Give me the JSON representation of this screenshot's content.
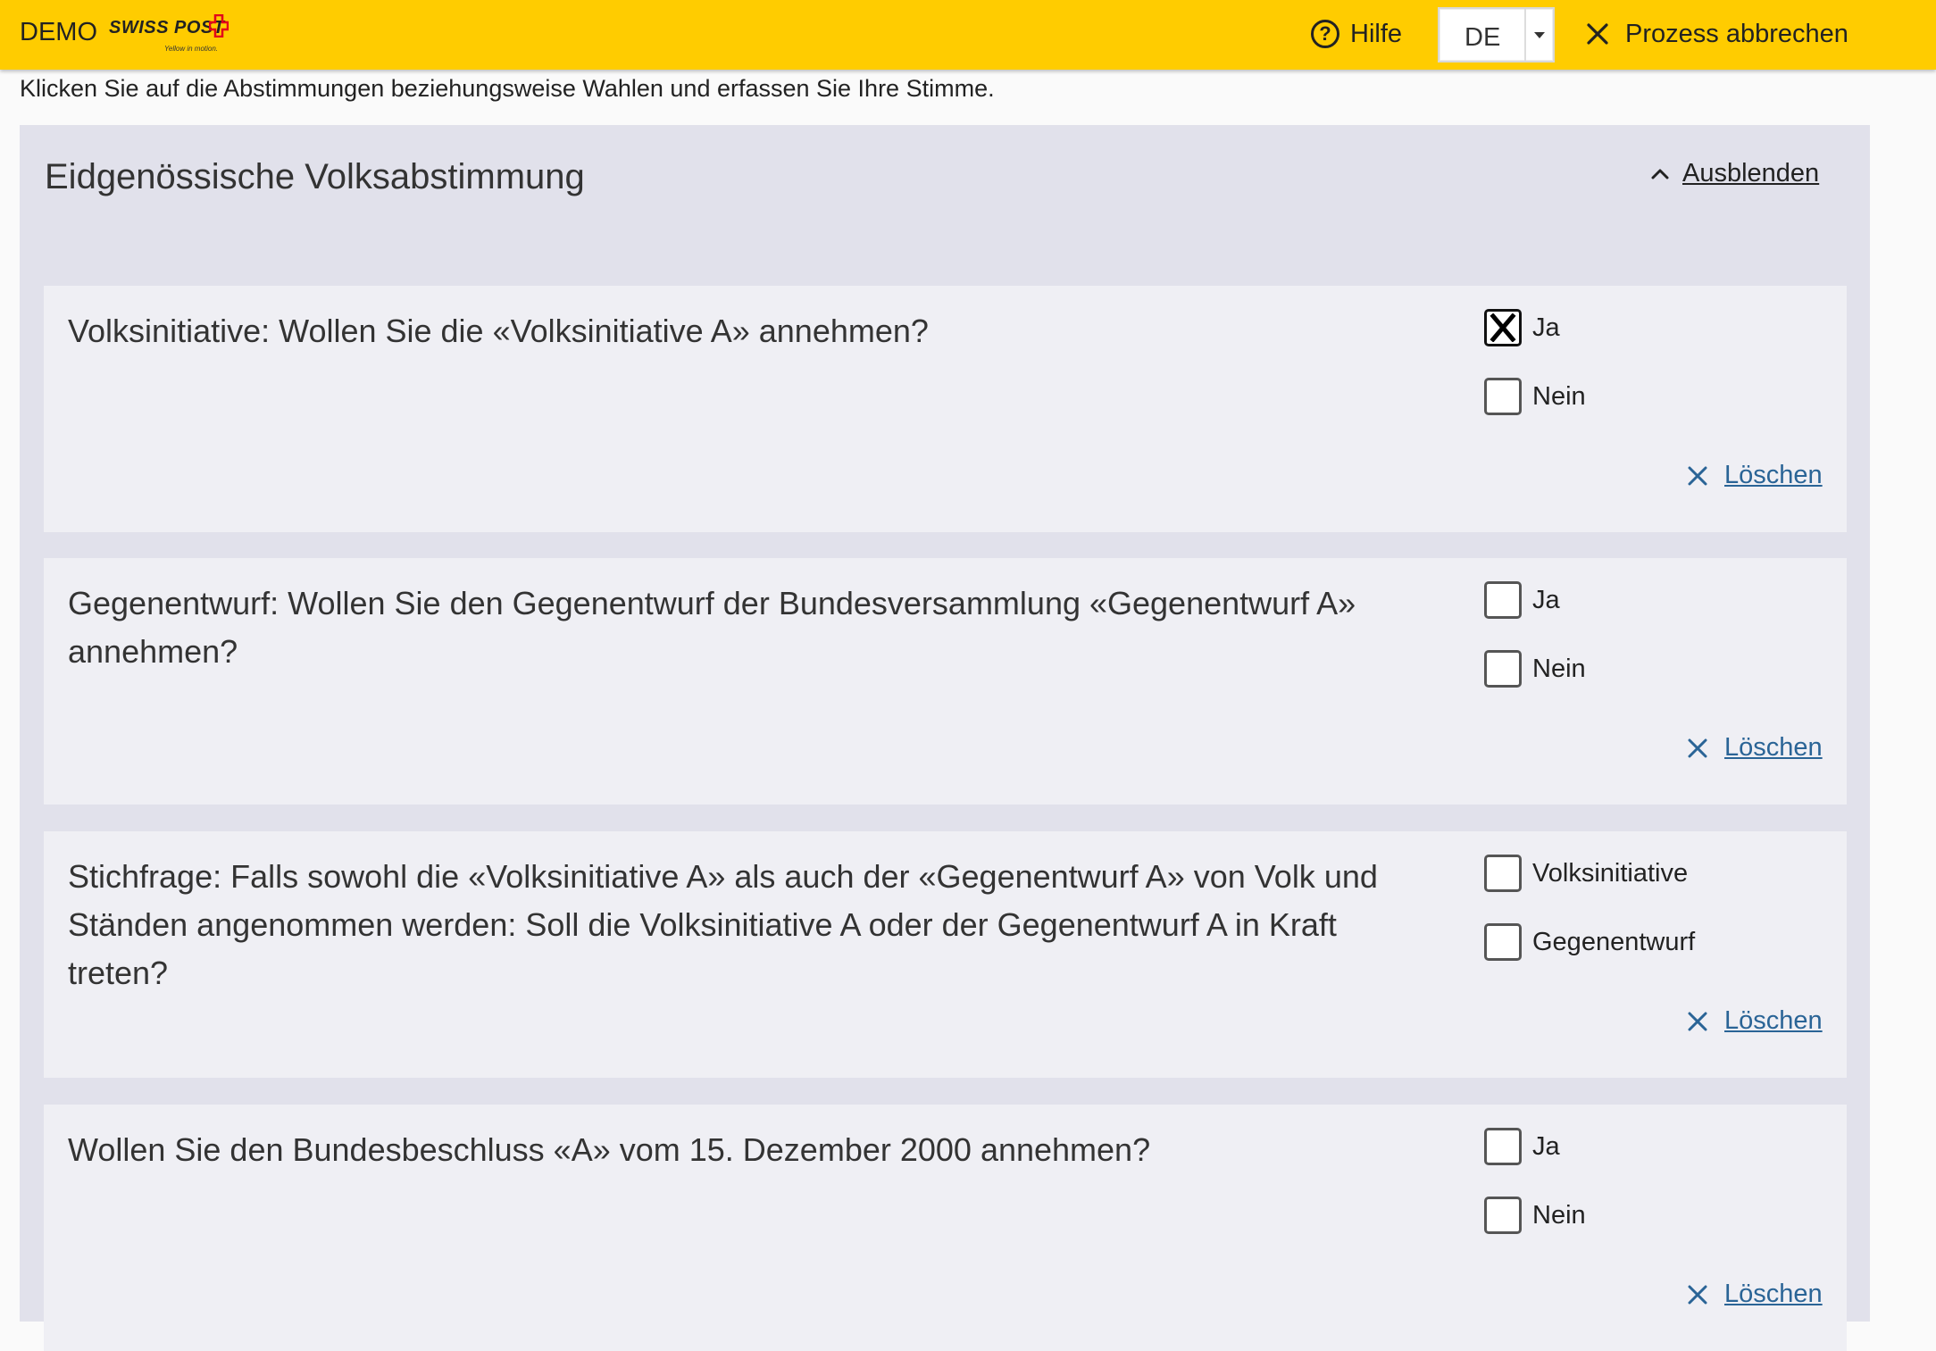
{
  "header": {
    "demo_label": "DEMO",
    "logo_text": "SWISS POST",
    "logo_slogan": "Yellow in motion.",
    "help_label": "Hilfe",
    "language_value": "DE",
    "cancel_label": "Prozess abbrechen",
    "bar_color": "#ffcc00"
  },
  "intro_text": "Klicken Sie auf die Abstimmungen beziehungsweise Wahlen und erfassen Sie Ihre Stimme.",
  "ballot": {
    "title": "Eidgenössische Volksabstimmung",
    "collapse_label": "Ausblenden",
    "questions": [
      {
        "text": "Volksinitiative: Wollen Sie die «Volksinitiative A» annehmen?",
        "options": [
          {
            "label": "Ja",
            "checked": true
          },
          {
            "label": "Nein",
            "checked": false
          }
        ],
        "clear_label": "Löschen"
      },
      {
        "text": "Gegenentwurf: Wollen Sie den Gegenentwurf der Bundesversammlung «Gegenentwurf A» annehmen?",
        "options": [
          {
            "label": "Ja",
            "checked": false
          },
          {
            "label": "Nein",
            "checked": false
          }
        ],
        "clear_label": "Löschen"
      },
      {
        "text": "Stichfrage: Falls sowohl die «Volksinitiative A» als auch der «Gegenentwurf A» von Volk und Ständen angenommen werden: Soll die Volksinitiative A oder der Gegenentwurf A in Kraft treten?",
        "options": [
          {
            "label": "Volksinitiative",
            "checked": false
          },
          {
            "label": "Gegenentwurf",
            "checked": false
          }
        ],
        "clear_label": "Löschen"
      },
      {
        "text": "Wollen Sie den Bundesbeschluss «A» vom 15. Dezember 2000 annehmen?",
        "options": [
          {
            "label": "Ja",
            "checked": false
          },
          {
            "label": "Nein",
            "checked": false
          }
        ],
        "clear_label": "Löschen"
      }
    ]
  }
}
